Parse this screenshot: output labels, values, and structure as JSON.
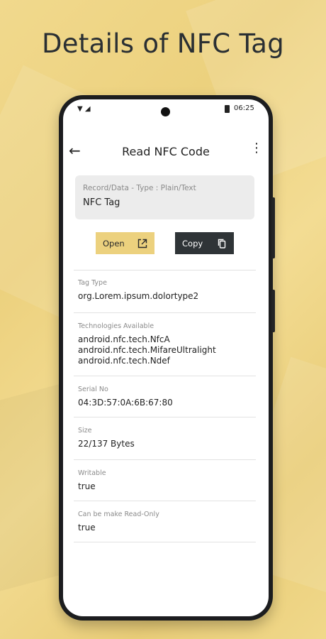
{
  "headline": "Details of NFC Tag",
  "status_bar": {
    "time": "06:25"
  },
  "app_bar": {
    "title": "Read NFC Code"
  },
  "record": {
    "label": "Record/Data - Type : Plain/Text",
    "value": "NFC Tag"
  },
  "actions": {
    "open_label": "Open",
    "copy_label": "Copy"
  },
  "fields": {
    "tag_type": {
      "label": "Tag Type",
      "value": "org.Lorem.ipsum.dolortype2"
    },
    "technologies": {
      "label": "Technologies Available",
      "values": [
        "android.nfc.tech.NfcA",
        "android.nfc.tech.MifareUltralight",
        "android.nfc.tech.Ndef"
      ]
    },
    "serial": {
      "label": "Serial No",
      "value": "04:3D:57:0A:6B:67:80"
    },
    "size": {
      "label": "Size",
      "value": "22/137 Bytes"
    },
    "writable": {
      "label": "Writable",
      "value": "true"
    },
    "read_only": {
      "label": "Can be make Read-Only",
      "value": "true"
    }
  }
}
